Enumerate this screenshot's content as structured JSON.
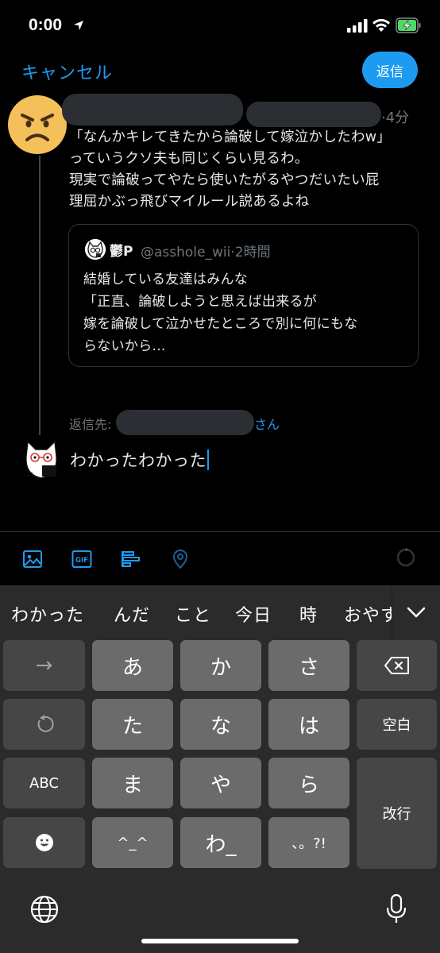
{
  "status_bar": {
    "time": "0:00"
  },
  "header": {
    "cancel_label": "キャンセル",
    "reply_label": "返信"
  },
  "tweet": {
    "age": "4分",
    "lines": [
      "「なんかキレてきたから論破して嫁泣かしたわw」",
      "っていうクソ夫も同じくらい見るわ。",
      "現実で論破ってやたら使いたがるやつだいたい屁",
      "理屈かぶっ飛びマイルール説あるよね"
    ]
  },
  "quote": {
    "name": "鬱P",
    "handle": "@asshole_wii",
    "age": "2時間",
    "lines": [
      "結婚している友達はみんな",
      "「正直、論破しようと思えば出来るが",
      "嫁を論破して泣かせたところで別に何にもな",
      "らないから..."
    ]
  },
  "reply_to": {
    "label": "返信先:",
    "suffix": "さん"
  },
  "composer": {
    "text": "わかったわかった"
  },
  "toolbar": {
    "icons": [
      "image-icon",
      "gif-icon",
      "poll-icon",
      "location-icon"
    ]
  },
  "keyboard": {
    "candidates": [
      "わかった",
      "んだ",
      "こと",
      "今日",
      "時",
      "おやす"
    ],
    "keys": {
      "arrow": "→",
      "a": "あ",
      "ka": "か",
      "sa": "さ",
      "ta": "た",
      "na": "な",
      "ha": "は",
      "space": "空白",
      "abc": "ABC",
      "ma": "ま",
      "ya": "や",
      "ra": "ら",
      "enter": "改行",
      "kaomoji": "^_^",
      "wa": "わ_",
      "punct": "、。?!"
    }
  },
  "colors": {
    "accent": "#1d9bf0",
    "muted": "#6e767d",
    "key": "#6b6b6b",
    "key_dark": "#464646"
  }
}
